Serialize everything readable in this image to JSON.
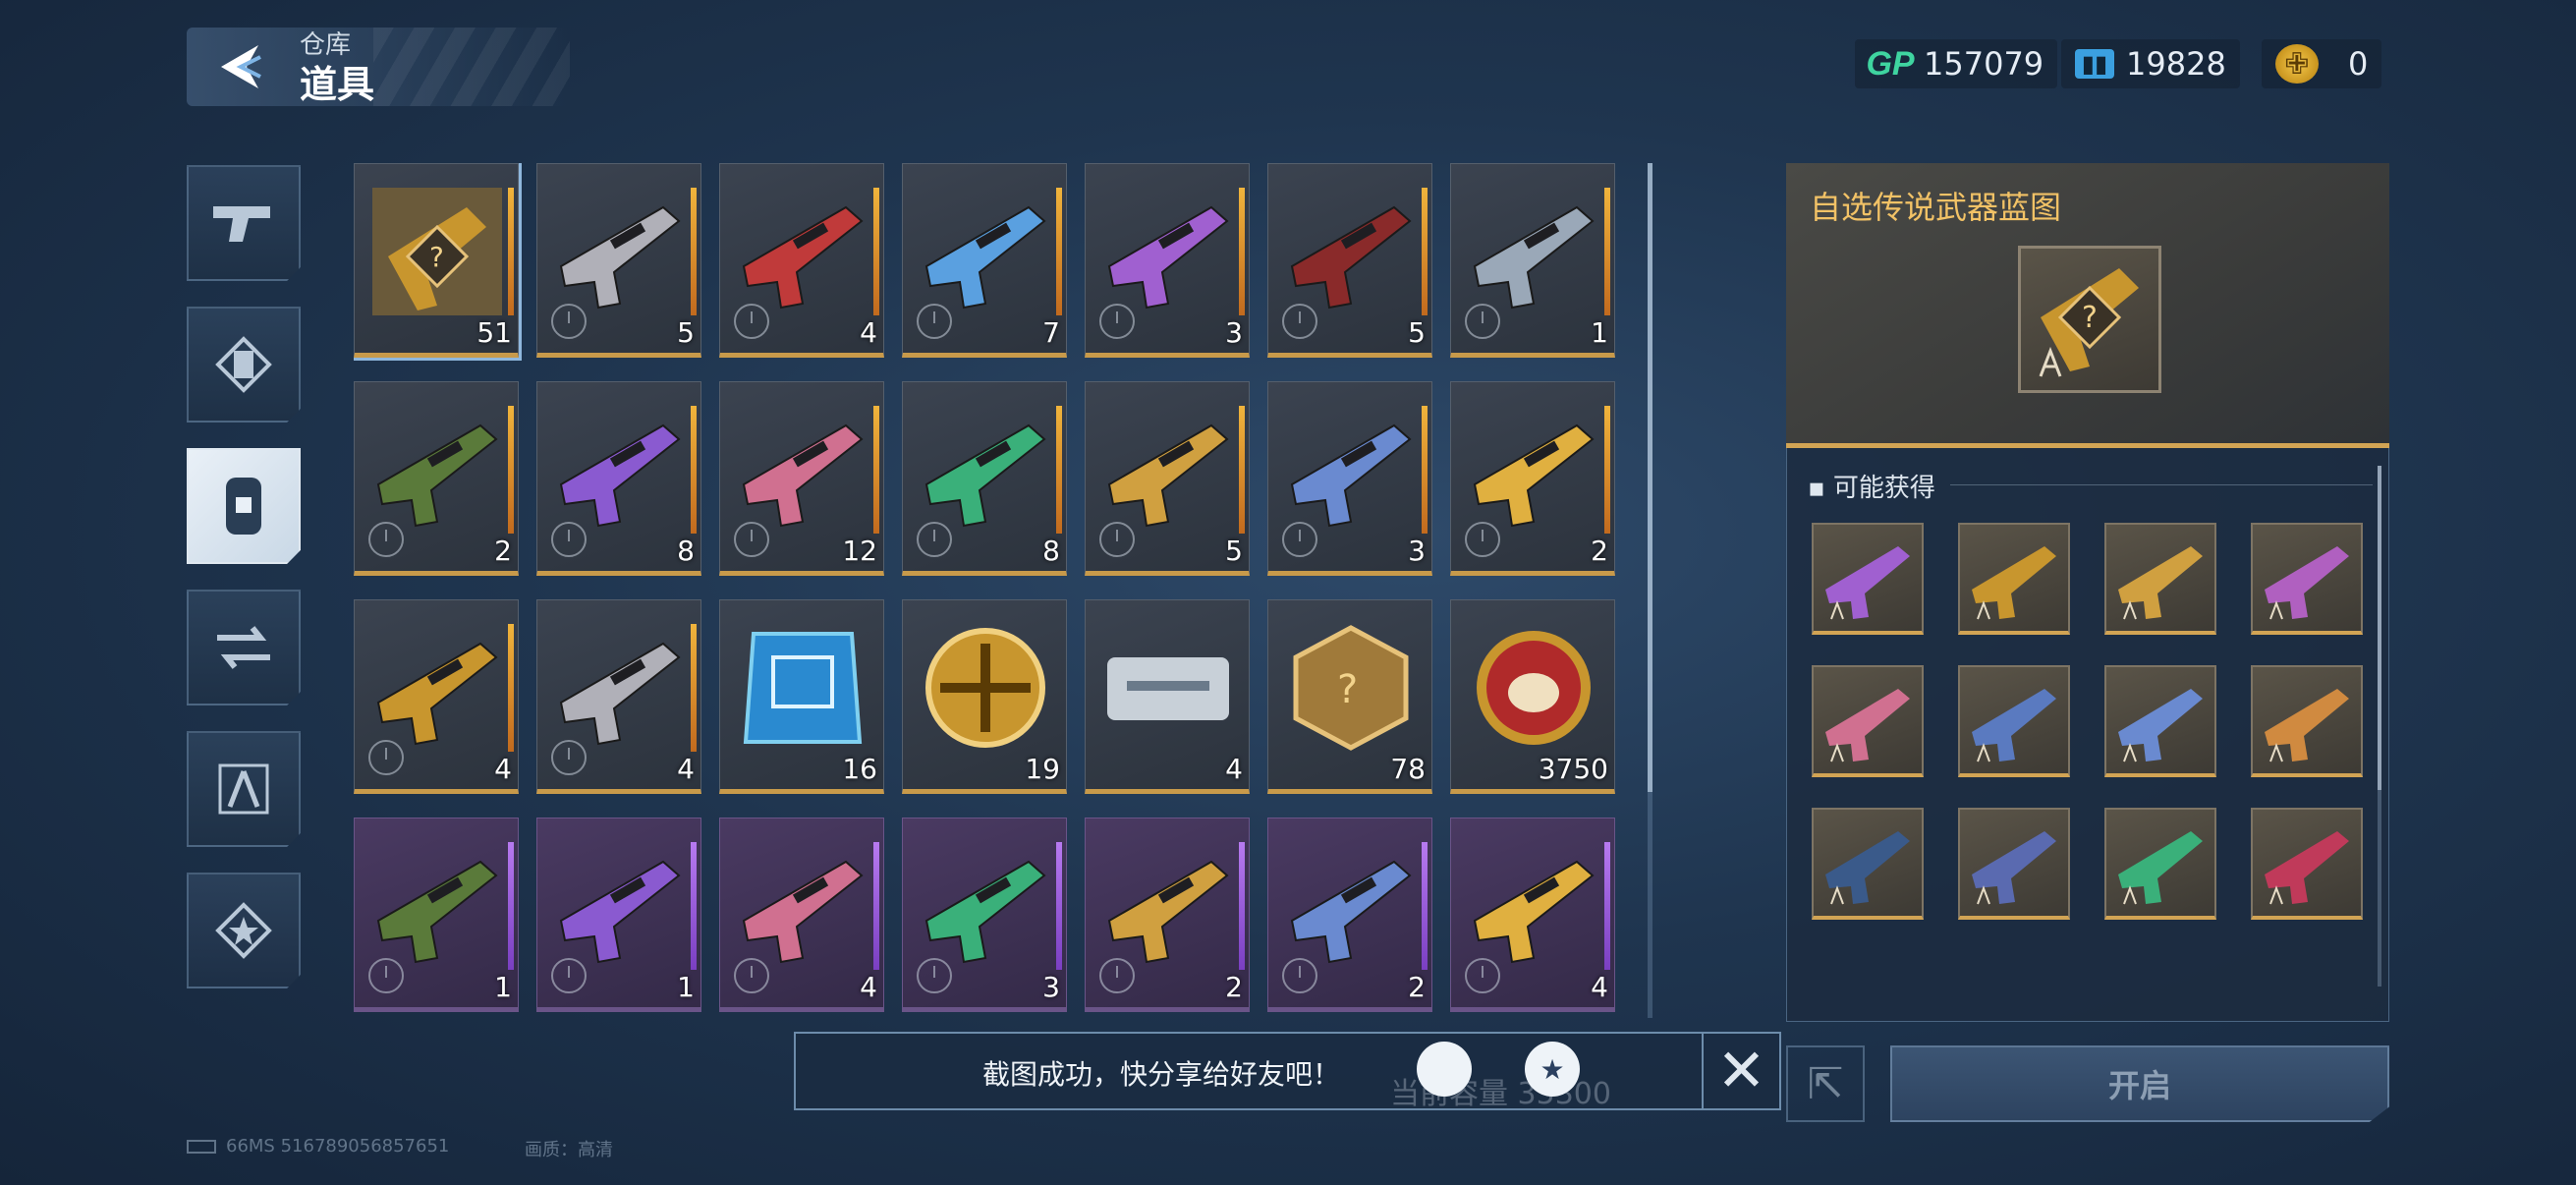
{
  "header": {
    "subtitle": "仓库",
    "title": "道具"
  },
  "currencies": [
    {
      "icon": "gp-icon",
      "label": "GP",
      "value": "157079"
    },
    {
      "icon": "ticket-icon",
      "value": "19828"
    },
    {
      "icon": "coin-icon",
      "value": "0"
    }
  ],
  "sidebar": {
    "items": [
      {
        "icon": "pistol-icon"
      },
      {
        "icon": "blueprint-scroll-icon"
      },
      {
        "icon": "item-canister-icon",
        "active": true
      },
      {
        "icon": "swap-icon"
      },
      {
        "icon": "compass-tool-icon"
      },
      {
        "icon": "star-badge-icon"
      }
    ]
  },
  "inventory": {
    "rows": [
      [
        {
          "name": "legendary-blueprint-box",
          "count": "51",
          "rarity": "gold",
          "selected": true
        },
        {
          "name": "gold-rifle",
          "count": "5",
          "rarity": "gold"
        },
        {
          "name": "red-rifle",
          "count": "4",
          "rarity": "gold"
        },
        {
          "name": "blue-rifle",
          "count": "7",
          "rarity": "gold"
        },
        {
          "name": "purple-rifle",
          "count": "3",
          "rarity": "gold"
        },
        {
          "name": "black-red-rifle",
          "count": "5",
          "rarity": "gold"
        },
        {
          "name": "steel-rifle",
          "count": "1",
          "rarity": "gold"
        }
      ],
      [
        {
          "name": "green-camo-rifle",
          "count": "2",
          "rarity": "gold"
        },
        {
          "name": "violet-rifle",
          "count": "8",
          "rarity": "gold"
        },
        {
          "name": "pink-blade",
          "count": "12",
          "rarity": "gold"
        },
        {
          "name": "green-rifle",
          "count": "8",
          "rarity": "gold"
        },
        {
          "name": "gold-blaster",
          "count": "5",
          "rarity": "gold"
        },
        {
          "name": "blue-knife",
          "count": "3",
          "rarity": "gold"
        },
        {
          "name": "yellow-smg",
          "count": "2",
          "rarity": "gold"
        }
      ],
      [
        {
          "name": "blue-smg",
          "count": "4",
          "rarity": "gold"
        },
        {
          "name": "yellow-pistol",
          "count": "4",
          "rarity": "gold"
        },
        {
          "name": "chip-card",
          "count": "16",
          "rarity": "gold"
        },
        {
          "name": "gold-medal",
          "count": "19",
          "rarity": "gold"
        },
        {
          "name": "white-case",
          "count": "4",
          "rarity": "gold"
        },
        {
          "name": "mystery-gun-badge",
          "count": "78",
          "rarity": "gold"
        },
        {
          "name": "red-pig-coin",
          "count": "3750",
          "rarity": "gold"
        }
      ],
      [
        {
          "name": "white-smg",
          "count": "1",
          "rarity": "purple"
        },
        {
          "name": "white-shotgun",
          "count": "1",
          "rarity": "purple"
        },
        {
          "name": "grey-rifle",
          "count": "4",
          "rarity": "purple"
        },
        {
          "name": "grey-lmg",
          "count": "3",
          "rarity": "purple"
        },
        {
          "name": "green-launcher",
          "count": "2",
          "rarity": "purple"
        },
        {
          "name": "silver-pistol",
          "count": "2",
          "rarity": "purple"
        },
        {
          "name": "crossbow",
          "count": "4",
          "rarity": "purple"
        }
      ]
    ]
  },
  "detail": {
    "title": "自选传说武器蓝图",
    "possible_label": "可能获得",
    "possible_count": 12
  },
  "bottom": {
    "toast_text": "截图成功，快分享给好友吧！",
    "under_text": "当前容量 35300",
    "open_label": "开启",
    "status_text": "66MS  516789056857651",
    "quality_text": "画质：高清"
  },
  "colors": {
    "gold": "#d2a454",
    "purple": "#9c5fd6",
    "accent": "#f2c266",
    "gp": "#3fd4a0"
  }
}
